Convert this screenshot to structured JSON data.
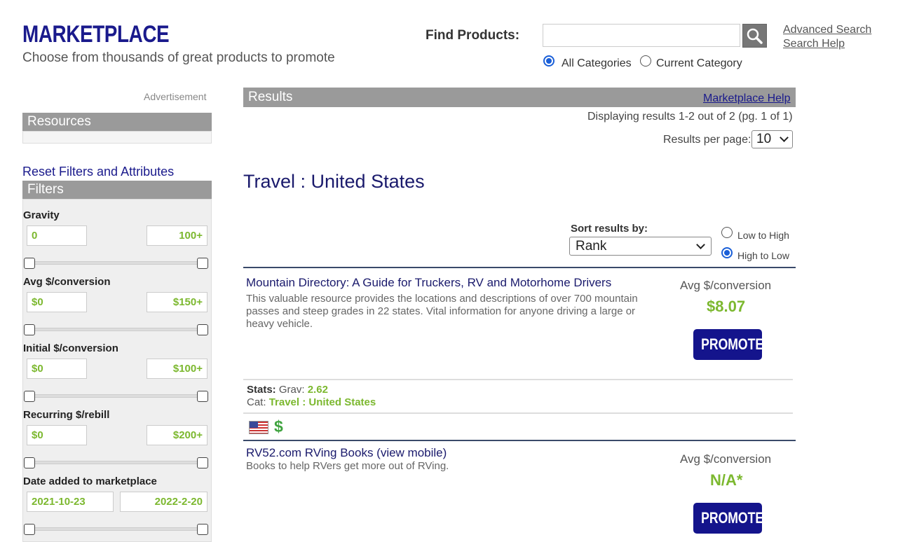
{
  "header": {
    "brand_title": "MARKETPLACE",
    "brand_subtitle": "Choose from thousands of great products to promote",
    "find_label": "Find Products:",
    "search_placeholder": "",
    "advanced_search": "Advanced Search",
    "search_help": "Search Help",
    "scope_options": [
      {
        "label": "All Categories",
        "selected": true
      },
      {
        "label": "Current Category",
        "selected": false
      }
    ]
  },
  "sidebar": {
    "ad_label": "Advertisement",
    "resources_title": "Resources",
    "reset_link": "Reset Filters and Attributes",
    "filters_title": "Filters",
    "filters": [
      {
        "label": "Gravity",
        "min": "0",
        "max": "100+"
      },
      {
        "label": "Avg $/conversion",
        "min": "$0",
        "max": "$150+"
      },
      {
        "label": "Initial $/conversion",
        "min": "$0",
        "max": "$100+"
      },
      {
        "label": "Recurring $/rebill",
        "min": "$0",
        "max": "$200+"
      },
      {
        "label": "Date added to marketplace",
        "min": "2021-10-23",
        "max": "2022-2-20"
      }
    ]
  },
  "results": {
    "header": "Results",
    "help_link": "Marketplace Help",
    "displaying": "Displaying results 1-2 out of 2 (pg. 1 of 1)",
    "per_page_label": "Results per page:",
    "per_page_value": "10",
    "category_title": "Travel : United States",
    "sort_label": "Sort results by:",
    "sort_value": "Rank",
    "order_options": [
      {
        "label": "Low to High",
        "selected": false
      },
      {
        "label": "High to Low",
        "selected": true
      }
    ],
    "products": [
      {
        "title": "Mountain Directory: A Guide for Truckers, RV and Motorhome Drivers",
        "description": "This valuable resource provides the locations and descriptions of over 700 mountain passes and steep grades in 22 states. Vital information for anyone driving a large or heavy vehicle.",
        "avg_label": "Avg $/conversion",
        "avg_value": "$8.07",
        "promote_label": "PROMOTE",
        "stats_label": "Stats:",
        "grav_label": "Grav:",
        "grav_value": "2.62",
        "cat_label": "Cat:",
        "cat_value": "Travel : United States",
        "flag_icon": "us-flag-icon",
        "dollar_icon": "$"
      },
      {
        "title": "RV52.com RVing Books (view mobile)",
        "description": "Books to help RVers get more out of RVing.",
        "avg_label": "Avg $/conversion",
        "avg_value": "N/A*",
        "promote_label": "PROMOTE"
      }
    ]
  },
  "colors": {
    "brand": "#1a1a8c",
    "accent_green": "#7cb82f",
    "panel_gray": "#9a9a9a",
    "button_blue": "#14148c"
  }
}
